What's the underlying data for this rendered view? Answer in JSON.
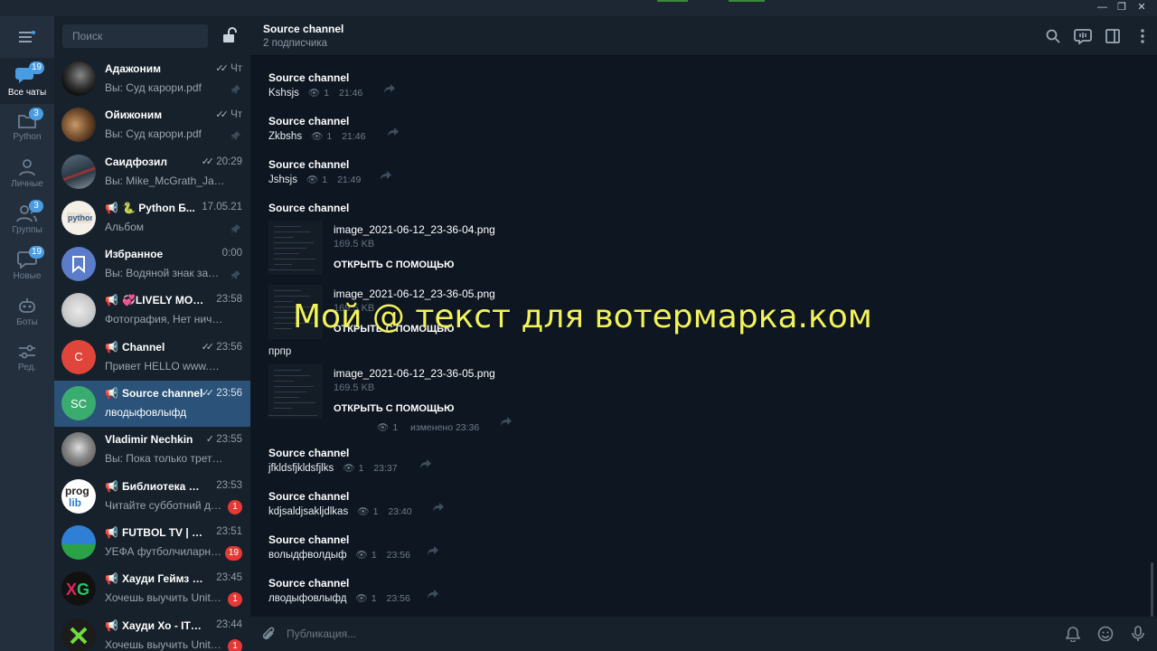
{
  "rail": {
    "folders": [
      {
        "label": "Все чаты",
        "badge": "19"
      },
      {
        "label": "Python",
        "badge": "3"
      },
      {
        "label": "Личные",
        "badge": ""
      },
      {
        "label": "Группы",
        "badge": "3"
      },
      {
        "label": "Новые",
        "badge": "19"
      },
      {
        "label": "Боты",
        "badge": ""
      },
      {
        "label": "Ред.",
        "badge": ""
      }
    ]
  },
  "search": {
    "placeholder": "Поиск"
  },
  "chats": [
    {
      "name": "Адажоним",
      "time": "Чт",
      "preview": "Вы: Суд карори.pdf"
    },
    {
      "name": "Ойижоним",
      "time": "Чт",
      "preview": "Вы: Суд карори.pdf"
    },
    {
      "name": "Саидфозил",
      "time": "20:29",
      "preview": "Вы: Mike_McGrath_Java_i..."
    },
    {
      "name": "🐍 Python Б...",
      "time": "17.05.21",
      "preview": "Альбом"
    },
    {
      "name": "Избранное",
      "time": "0:00",
      "preview": "Вы: Водяной знак задан..."
    },
    {
      "name": "💞LIVELY MOMEN...",
      "time": "23:58",
      "preview": "Фотография, Нет ничего лу..."
    },
    {
      "name": "Channel",
      "time": "23:56",
      "preview": "Привет HELLO www.pythex....",
      "initials": "C"
    },
    {
      "name": "Source channel",
      "time": "23:56",
      "preview": "лводыфовлыфд",
      "initials": "SC"
    },
    {
      "name": "Vladimir Nechkin",
      "time": "23:55",
      "preview": "Вы: Пока только третий пун..."
    },
    {
      "name": "Библиотека прог...",
      "time": "23:53",
      "preview": "Читайте субботний дай...",
      "unread": "1"
    },
    {
      "name": "FUTBOL TV | EUR...",
      "time": "23:51",
      "preview": "УЕФА футболчиларнин...",
      "unread": "19"
    },
    {
      "name": "Хауди Геймз - Ге...",
      "time": "23:45",
      "preview": "Хочешь выучить Unity (...",
      "unread": "1"
    },
    {
      "name": "Хауди Хо - IT юмо...",
      "time": "23:44",
      "preview": "Хочешь выучить Unity (...",
      "unread": "1"
    }
  ],
  "header": {
    "title": "Source channel",
    "subtitle": "2 подписчика"
  },
  "messages": [
    {
      "author": "Source channel",
      "text": "Kshsjs",
      "views": "1",
      "time": "21:46"
    },
    {
      "author": "Source channel",
      "text": "Zkbshs",
      "views": "1",
      "time": "21:46"
    },
    {
      "author": "Source channel",
      "text": "Jshsjs",
      "views": "1",
      "time": "21:49"
    },
    {
      "author": "Source channel"
    }
  ],
  "files": [
    {
      "name": "image_2021-06-12_23-36-04.png",
      "size": "169.5 KB",
      "action": "ОТКРЫТЬ С ПОМОЩЬЮ"
    },
    {
      "name": "image_2021-06-12_23-36-05.png",
      "size": "169.5 KB",
      "action": "ОТКРЫТЬ С ПОМОЩЬЮ"
    },
    {
      "name": "image_2021-06-12_23-36-05.png",
      "size": "169.5 KB",
      "action": "ОТКРЫТЬ С ПОМОЩЬЮ"
    }
  ],
  "caption": "прпр",
  "album_meta": {
    "views": "1",
    "time": "изменено 23:36"
  },
  "messages2": [
    {
      "author": "Source channel",
      "text": "jfkldsfjkldsfjlks",
      "views": "1",
      "time": "23:37"
    },
    {
      "author": "Source channel",
      "text": "kdjsaldjsakljdlkas",
      "views": "1",
      "time": "23:40"
    },
    {
      "author": "Source channel",
      "text": "волыдфволдыф",
      "views": "1",
      "time": "23:56"
    },
    {
      "author": "Source channel",
      "text": "лводыфовлыфд",
      "views": "1",
      "time": "23:56"
    }
  ],
  "composer": {
    "placeholder": "Публикация..."
  },
  "watermark": "Мой @ текст для вотермарка.ком"
}
